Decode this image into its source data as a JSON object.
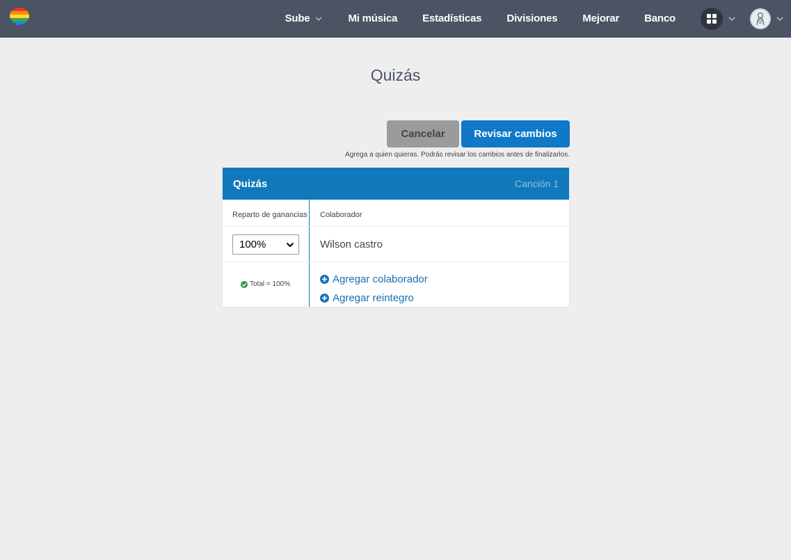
{
  "nav": {
    "items": [
      "Sube",
      "Mi música",
      "Estadísticas",
      "Divisiones",
      "Mejorar",
      "Banco"
    ],
    "sube_has_dropdown": true
  },
  "page": {
    "title": "Quizás",
    "cancel_label": "Cancelar",
    "review_label": "Revisar cambios",
    "hint": "Agrega a quien quieras. Podrás revisar los cambios antes de finalizarlos."
  },
  "card": {
    "title": "Quizás",
    "subtitle": "Canción 1",
    "col_split": "Reparto de ganancias",
    "col_collab": "Colaborador",
    "split_value": "100%",
    "collaborator": "Wilson castro",
    "total": "Total = 100%",
    "add_collaborator": "Agregar colaborador",
    "add_refund": "Agregar reintegro"
  },
  "colors": {
    "topbar": "#4a5463",
    "accent": "#1179bb",
    "button_primary": "#0f78c8",
    "button_cancel": "#9b9b9b",
    "link": "#1a6fb0",
    "success": "#2e9b3e"
  },
  "icons": [
    "logo-icon",
    "chevron-down-icon",
    "apps-grid-icon",
    "avatar-icon",
    "check-circle-icon",
    "plus-circle-icon"
  ]
}
